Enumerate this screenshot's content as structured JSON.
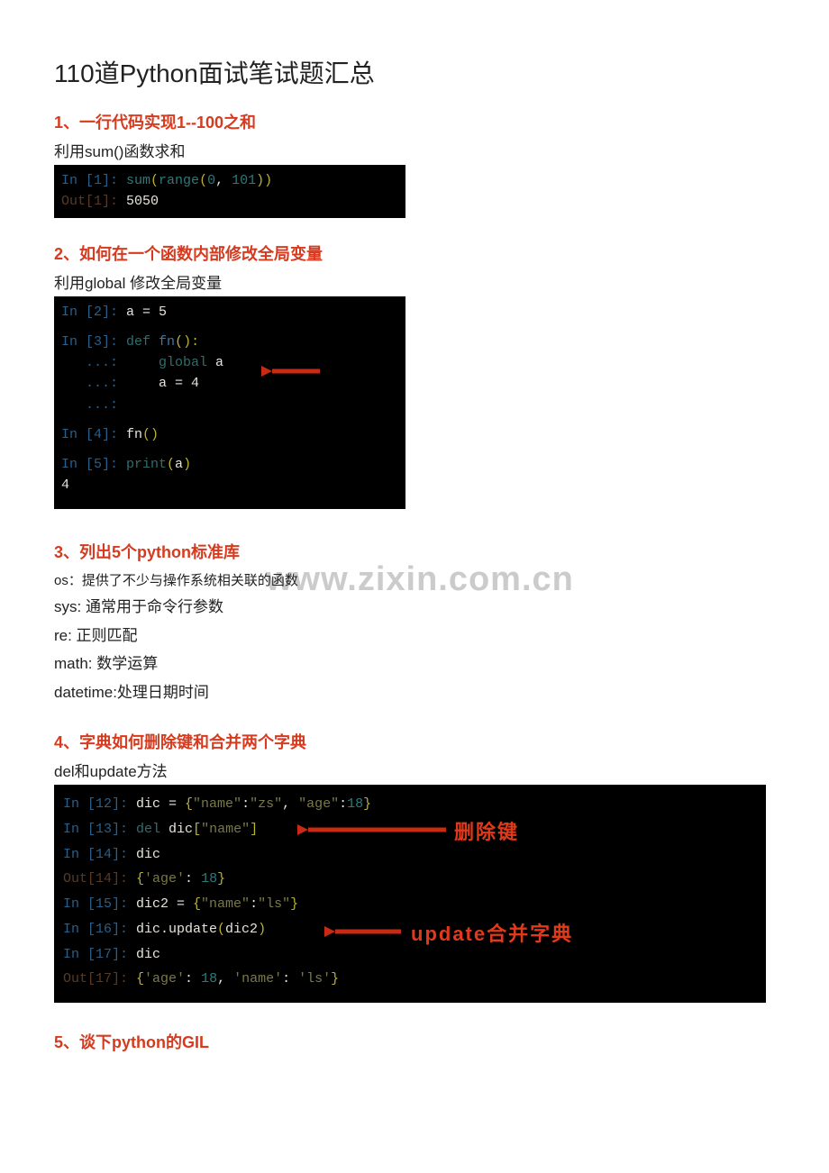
{
  "title": "110道Python面试笔试题汇总",
  "watermark": "www.zixin.com.cn",
  "q1": {
    "heading": "1、一行代码实现1--100之和",
    "note": "利用sum()函数求和",
    "code": {
      "in_prompt": "In [1]: ",
      "expr_sum": "sum",
      "expr_lp1": "(",
      "expr_range": "range",
      "expr_lp2": "(",
      "expr_a": "0",
      "expr_comma": ", ",
      "expr_b": "101",
      "expr_rp2": ")",
      "expr_rp1": ")",
      "out_prompt": "Out[1]: ",
      "out_val": "5050"
    }
  },
  "q2": {
    "heading": "2、如何在一个函数内部修改全局变量",
    "note": "利用global 修改全局变量",
    "code": {
      "l1_prompt": "In [2]: ",
      "l1_text": "a = 5",
      "l2_prompt": "In [3]: ",
      "l2_def": "def",
      "l2_sp": " ",
      "l2_fn": "fn",
      "l2_pr": "():",
      "l3_dots": "   ...:     ",
      "l3_global": "global",
      "l3_sp": " a",
      "l4_dots": "   ...:     ",
      "l4_txt": "a = 4",
      "l5_dots": "   ...:",
      "l6_prompt": "In [4]: ",
      "l6_fn": "fn",
      "l6_pr": "()",
      "l7_prompt": "In [5]: ",
      "l7_print": "print",
      "l7_lp": "(",
      "l7_a": "a",
      "l7_rp": ")",
      "l8": "4"
    }
  },
  "q3": {
    "heading": "3、列出5个python标准库",
    "lines": [
      "os：提供了不少与操作系统相关联的函数",
      "sys:   通常用于命令行参数",
      "re:   正则匹配",
      "math: 数学运算",
      "datetime:处理日期时间"
    ]
  },
  "q4": {
    "heading": "4、字典如何删除键和合并两个字典",
    "note": "del和update方法",
    "annot1": "删除键",
    "annot2": "update合并字典",
    "code": {
      "l1_p": "In [12]: ",
      "l1_a": "dic = ",
      "l1_lb": "{",
      "l1_q1": "\"name\"",
      "l1_c1": ":",
      "l1_q2": "\"zs\"",
      "l1_cm": ", ",
      "l1_q3": "\"age\"",
      "l1_c2": ":",
      "l1_v": "18",
      "l1_rb": "}",
      "l2_p": "In [13]: ",
      "l2_a": "del",
      "l2_sp": " ",
      "l2_b": "dic",
      "l2_lb": "[",
      "l2_q": "\"name\"",
      "l2_rb": "]",
      "l3_p": "In [14]: ",
      "l3_a": "dic",
      "l3b_p": "Out[14]: ",
      "l3b_lb": "{",
      "l3b_q": "'age'",
      "l3b_c": ": ",
      "l3b_v": "18",
      "l3b_rb": "}",
      "l4_p": "In [15]: ",
      "l4_a": "dic2 = ",
      "l4_lb": "{",
      "l4_q1": "\"name\"",
      "l4_c": ":",
      "l4_q2": "\"ls\"",
      "l4_rb": "}",
      "l5_p": "In [16]: ",
      "l5_a": "dic.update",
      "l5_lp": "(",
      "l5_b": "dic2",
      "l5_rp": ")",
      "l6_p": "In [17]: ",
      "l6_a": "dic",
      "l6b_p": "Out[17]: ",
      "l6b_lb": "{",
      "l6b_q1": "'age'",
      "l6b_c1": ": ",
      "l6b_v": "18",
      "l6b_cm": ", ",
      "l6b_q2": "'name'",
      "l6b_c2": ": ",
      "l6b_q3": "'ls'",
      "l6b_rb": "}"
    }
  },
  "q5": {
    "heading": "5、谈下python的GIL"
  }
}
